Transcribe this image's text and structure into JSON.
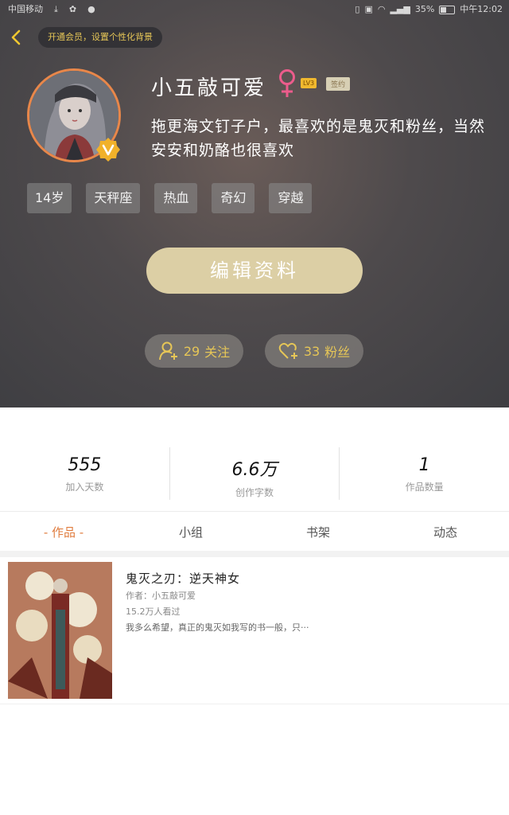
{
  "status_bar": {
    "carrier": "中国移动",
    "battery": "35%",
    "time": "中午12:02"
  },
  "header": {
    "vip_prompt": "开通会员，设置个性化背景"
  },
  "profile": {
    "nickname": "小五敲可爱",
    "level": "LV3",
    "signed_label": "签约",
    "bio": "拖更海文钉子户，最喜欢的是鬼灭和粉丝，当然安安和奶酪也很喜欢",
    "tags": [
      "14岁",
      "天秤座",
      "热血",
      "奇幻",
      "穿越"
    ],
    "edit_button": "编辑资料",
    "following_count": "29",
    "following_label": "关注",
    "fans_count": "33",
    "fans_label": "粉丝"
  },
  "stats": [
    {
      "value": "555",
      "label": "加入天数"
    },
    {
      "value": "6.6万",
      "label": "创作字数"
    },
    {
      "value": "1",
      "label": "作品数量"
    }
  ],
  "tabs": [
    {
      "label": "- 作品 -",
      "active": true
    },
    {
      "label": "小组",
      "active": false
    },
    {
      "label": "书架",
      "active": false
    },
    {
      "label": "动态",
      "active": false
    }
  ],
  "works": [
    {
      "title": "鬼灭之刃：逆天神女",
      "author": "作者：小五敲可爱",
      "reads": "15.2万人看过",
      "desc": "我多么希望，真正的鬼灭如我写的书一般，只···"
    }
  ],
  "colors": {
    "accent_gold": "#e6c657",
    "tab_active": "#e07c3e",
    "avatar_ring": "#e8874a"
  }
}
